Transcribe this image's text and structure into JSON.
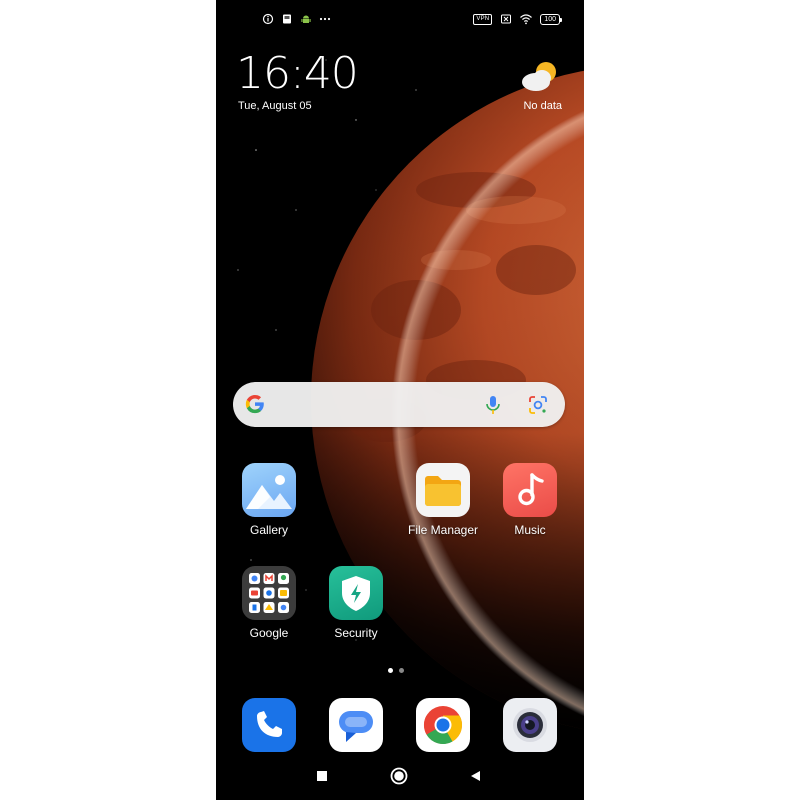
{
  "status_bar": {
    "left_icons": [
      "info-icon",
      "screenshot-icon",
      "android-icon",
      "more-dots-icon"
    ],
    "vpn": "VPN",
    "battery": "100",
    "right_icons": [
      "vpn-icon",
      "sim-off-icon",
      "wifi-icon",
      "battery-icon"
    ]
  },
  "clock": {
    "time": "16:40",
    "date": "Tue, August 05"
  },
  "weather": {
    "text": "No data",
    "icon": "partly-cloudy-icon"
  },
  "search": {
    "icons": [
      "google-g-icon",
      "mic-icon",
      "lens-icon"
    ]
  },
  "apps": [
    {
      "label": "Gallery",
      "icon": "gallery-icon"
    },
    {
      "label": "File Manager",
      "icon": "folder-icon"
    },
    {
      "label": "Music",
      "icon": "music-note-icon"
    },
    {
      "label": "Google",
      "icon": "google-folder-icon"
    },
    {
      "label": "Security",
      "icon": "shield-bolt-icon"
    }
  ],
  "dock": [
    {
      "icon": "phone-icon"
    },
    {
      "icon": "messages-icon"
    },
    {
      "icon": "chrome-icon"
    },
    {
      "icon": "camera-icon"
    }
  ],
  "pages": {
    "count": 2,
    "current": 1
  },
  "nav": {
    "icons": [
      "recents-square-icon",
      "home-circle-icon",
      "back-triangle-icon"
    ]
  },
  "colors": {
    "mars": "#c2552a",
    "files_yellow": "#f6b624",
    "music_red": "#ef5350",
    "security_green": "#1bab8a",
    "phone_blue": "#1a73e8"
  }
}
